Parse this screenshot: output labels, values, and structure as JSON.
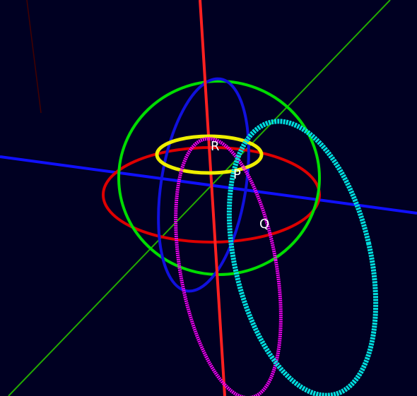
{
  "scene": {
    "background": "#000022",
    "axes": [
      {
        "id": "vertical-axis",
        "color": "#ff2020"
      },
      {
        "id": "horizontal-axis",
        "color": "#1010ff"
      },
      {
        "id": "depth-axis",
        "color": "#22aa00"
      }
    ],
    "circles": [
      {
        "id": "green-sphere-outline",
        "color": "#00dd00"
      },
      {
        "id": "red-equator-circle",
        "color": "#dd0000"
      },
      {
        "id": "blue-meridian-circle",
        "color": "#1111dd"
      },
      {
        "id": "yellow-small-circle",
        "color": "#eeee00"
      },
      {
        "id": "magenta-circle",
        "color": "#ee00ee"
      },
      {
        "id": "cyan-circle",
        "color": "#00dddd"
      }
    ],
    "points": [
      {
        "id": "point-r",
        "label": "R"
      },
      {
        "id": "point-p",
        "label": "P"
      },
      {
        "id": "point-q",
        "label": "Q"
      }
    ]
  }
}
